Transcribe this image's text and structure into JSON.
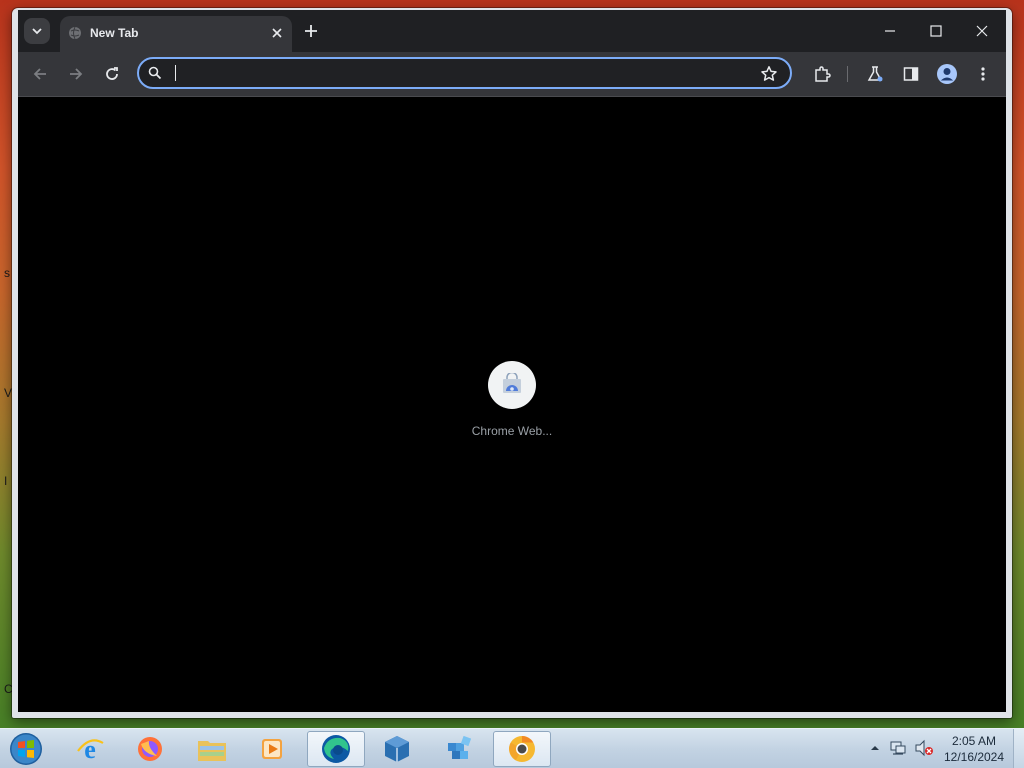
{
  "browser": {
    "tab": {
      "title": "New Tab"
    },
    "omnibox": {
      "value": "",
      "placeholder": ""
    },
    "shortcuts": [
      {
        "label": "Chrome Web..."
      }
    ]
  },
  "taskbar": {
    "apps": [
      {
        "name": "Internet Explorer"
      },
      {
        "name": "Firefox"
      },
      {
        "name": "File Explorer"
      },
      {
        "name": "Media Player"
      },
      {
        "name": "Edge"
      },
      {
        "name": "VirtualBox"
      },
      {
        "name": "Registry Editor"
      },
      {
        "name": "Chrome"
      }
    ],
    "clock": {
      "time": "2:05 AM",
      "date": "12/16/2024"
    }
  },
  "desktop": {
    "edge_letters": [
      "s",
      "V",
      "I",
      "C"
    ]
  },
  "colors": {
    "accent": "#7cacf8",
    "window_bg": "#000000",
    "toolbar": "#35363a",
    "titlebar": "#1f2023"
  }
}
